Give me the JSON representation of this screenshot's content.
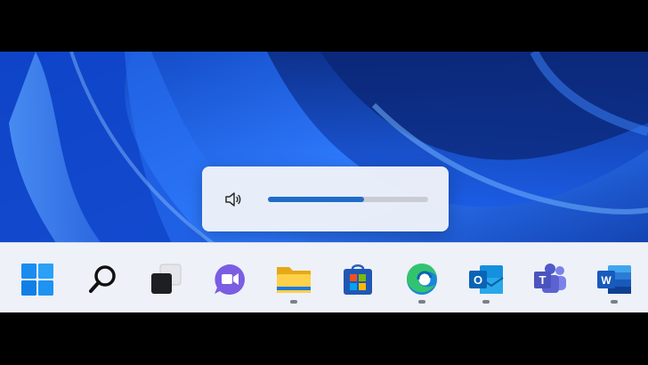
{
  "volume": {
    "level_percent": 60,
    "icon": "speaker-icon"
  },
  "taskbar": {
    "items": [
      {
        "name": "start",
        "icon": "windows-start-icon",
        "running": false
      },
      {
        "name": "search",
        "icon": "search-icon",
        "running": false
      },
      {
        "name": "task-view",
        "icon": "task-view-icon",
        "running": false
      },
      {
        "name": "chat",
        "icon": "chat-icon",
        "running": false
      },
      {
        "name": "file-explorer",
        "icon": "file-explorer-icon",
        "running": true
      },
      {
        "name": "microsoft-store",
        "icon": "store-icon",
        "running": false
      },
      {
        "name": "edge",
        "icon": "edge-icon",
        "running": true
      },
      {
        "name": "outlook",
        "icon": "outlook-icon",
        "running": true
      },
      {
        "name": "teams",
        "icon": "teams-icon",
        "running": false
      },
      {
        "name": "word",
        "icon": "word-icon",
        "running": true
      }
    ]
  },
  "colors": {
    "wallpaper": "#1a5be6",
    "accent": "#1f6cc9",
    "taskbar": "#eef1f8"
  }
}
